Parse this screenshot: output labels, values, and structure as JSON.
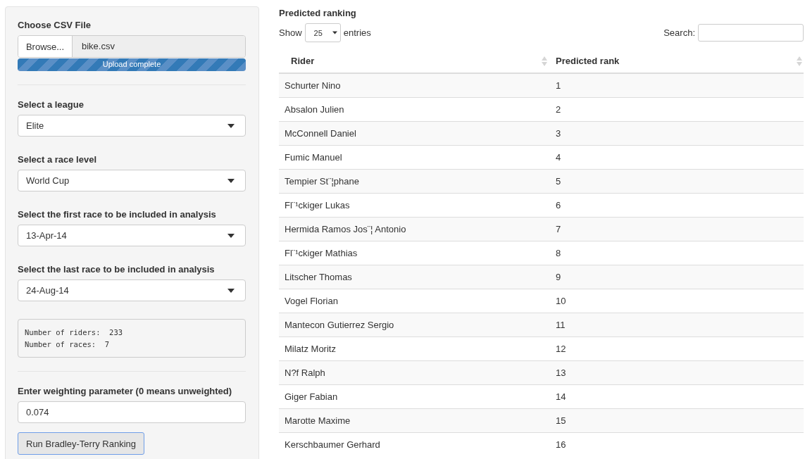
{
  "sidebar": {
    "file_input": {
      "label": "Choose CSV File",
      "button": "Browse...",
      "value": "bike.csv",
      "progress": {
        "text": "Upload complete",
        "level": 1
      }
    },
    "selects": [
      {
        "label": "Select a league",
        "value": "Elite"
      },
      {
        "label": "Select a race level",
        "value": "World Cup"
      },
      {
        "label": "Select the first race to be included in analysis",
        "value": "13-Apr-14"
      },
      {
        "label": "Select the last race to be included in analysis",
        "value": "24-Aug-14"
      }
    ],
    "summary": [
      "Number of riders:  233",
      "Number of races:  7"
    ],
    "weight": {
      "label": "Enter weighting parameter (0 means unweighted)",
      "value": "0.074"
    },
    "run_button": "Run Bradley-Terry Ranking"
  },
  "main": {
    "title": "Predicted ranking",
    "length": {
      "before": "Show",
      "value": "25",
      "after": "entries"
    },
    "search_label": "Search:",
    "table": {
      "columns": [
        "Rider",
        "Predicted rank"
      ],
      "rows": [
        [
          "Schurter Nino",
          "1"
        ],
        [
          "Absalon Julien",
          "2"
        ],
        [
          "McConnell Daniel",
          "3"
        ],
        [
          "Fumic Manuel",
          "4"
        ],
        [
          "Tempier St¨¦phane",
          "5"
        ],
        [
          "Fl¨¹ckiger Lukas",
          "6"
        ],
        [
          "Hermida Ramos Jos¨¦ Antonio",
          "7"
        ],
        [
          "Fl¨¹ckiger Mathias",
          "8"
        ],
        [
          "Litscher Thomas",
          "9"
        ],
        [
          "Vogel Florian",
          "10"
        ],
        [
          "Mantecon Gutierrez Sergio",
          "11"
        ],
        [
          "Milatz Moritz",
          "12"
        ],
        [
          "N?f Ralph",
          "13"
        ],
        [
          "Giger Fabian",
          "14"
        ],
        [
          "Marotte Maxime",
          "15"
        ],
        [
          "Kerschbaumer Gerhard",
          "16"
        ]
      ]
    }
  }
}
